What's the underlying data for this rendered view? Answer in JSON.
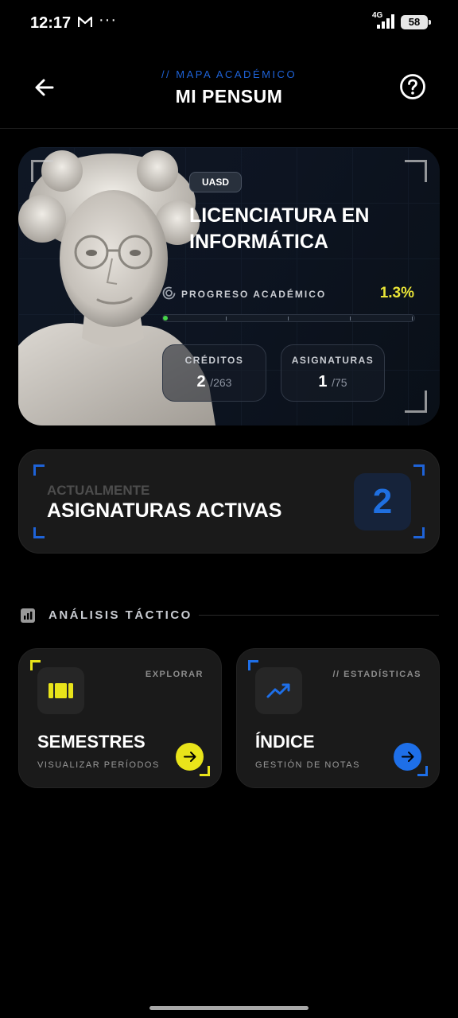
{
  "status_bar": {
    "time": "12:17",
    "network": "4G",
    "battery": "58"
  },
  "header": {
    "subtitle": "// MAPA ACADÉMICO",
    "title": "MI PENSUM"
  },
  "hero": {
    "badge": "UASD",
    "degree": "LICENCIATURA EN INFORMÁTICA",
    "progress_label": "PROGRESO ACADÉMICO",
    "progress_value": "1.3%",
    "progress_fraction": 0.013,
    "credits": {
      "label": "CRÉDITOS",
      "value": "2",
      "total": "/263"
    },
    "subjects": {
      "label": "ASIGNATURAS",
      "value": "1",
      "total": "/75"
    }
  },
  "active": {
    "subtitle": "ACTUALMENTE",
    "title": "ASIGNATURAS ACTIVAS",
    "count": "2"
  },
  "section": {
    "title": "ANÁLISIS TÁCTICO"
  },
  "tiles": [
    {
      "tag": "EXPLORAR",
      "title": "SEMESTRES",
      "subtitle": "VISUALIZAR PERÍODOS",
      "accent": "#e9e41a",
      "icon": "semesters-icon"
    },
    {
      "tag": "// ESTADÍSTICAS",
      "title": "ÍNDICE",
      "subtitle": "GESTIÓN DE NOTAS",
      "accent": "#1e6fe8",
      "icon": "trend-icon"
    }
  ],
  "colors": {
    "accent_blue": "#1e63d8",
    "accent_yellow": "#e9e437",
    "progress_green": "#46d54a",
    "background": "#000000",
    "card": "#1a1a1a"
  }
}
